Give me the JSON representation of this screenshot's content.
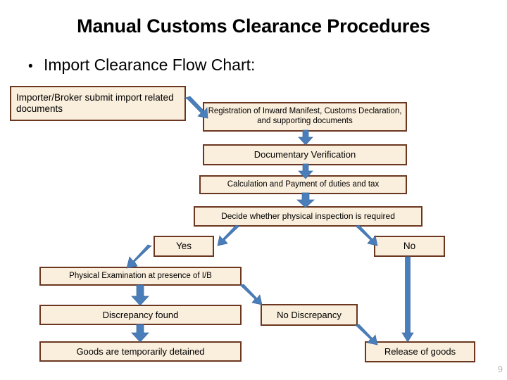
{
  "slide": {
    "title": "Manual Customs Clearance Procedures",
    "bullet_marker": "•",
    "bullet_text": "Import Clearance Flow Chart:",
    "page_number": "9",
    "colors": {
      "box_fill": "#faeedc",
      "box_border": "#6b3720",
      "arrow": "#4a7ebb",
      "text": "#000000",
      "background": "#ffffff"
    }
  },
  "chart_data": {
    "type": "diagram",
    "title": "Import Clearance Flow Chart",
    "nodes": [
      {
        "id": "n1",
        "label": "Importer/Broker submit import related documents"
      },
      {
        "id": "n2",
        "label": "Registration of Inward Manifest, Customs Declaration, and supporting documents"
      },
      {
        "id": "n3",
        "label": "Documentary Verification"
      },
      {
        "id": "n4",
        "label": "Calculation and Payment of duties and tax"
      },
      {
        "id": "n5",
        "label": "Decide whether physical inspection is required"
      },
      {
        "id": "n6",
        "label": "Yes"
      },
      {
        "id": "n7",
        "label": "No"
      },
      {
        "id": "n8",
        "label": "Physical Examination at presence of I/B"
      },
      {
        "id": "n9",
        "label": "Discrepancy found"
      },
      {
        "id": "n10",
        "label": "No Discrepancy"
      },
      {
        "id": "n11",
        "label": "Goods are temporarily detained"
      },
      {
        "id": "n12",
        "label": "Release of goods"
      }
    ],
    "edges": [
      {
        "from": "n1",
        "to": "n2",
        "style": "diagonal-down-right"
      },
      {
        "from": "n2",
        "to": "n3",
        "style": "vertical-down"
      },
      {
        "from": "n3",
        "to": "n4",
        "style": "vertical-down"
      },
      {
        "from": "n4",
        "to": "n5",
        "style": "vertical-down"
      },
      {
        "from": "n5",
        "to": "n6",
        "style": "diagonal-down-left"
      },
      {
        "from": "n5",
        "to": "n7",
        "style": "diagonal-down-right"
      },
      {
        "from": "n6",
        "to": "n8",
        "style": "diagonal-down-left"
      },
      {
        "from": "n7",
        "to": "n12",
        "style": "vertical-down-long"
      },
      {
        "from": "n8",
        "to": "n9",
        "style": "vertical-down"
      },
      {
        "from": "n8",
        "to": "n10",
        "style": "diagonal-down-right"
      },
      {
        "from": "n9",
        "to": "n11",
        "style": "vertical-down"
      },
      {
        "from": "n10",
        "to": "n12",
        "style": "diagonal-down-right"
      }
    ]
  },
  "boxes": {
    "importer_submit": "Importer/Broker submit import related documents",
    "registration": "Registration of Inward Manifest, Customs Declaration, and supporting documents",
    "documentary_verification": "Documentary Verification",
    "calculation_payment": "Calculation and Payment of duties and tax",
    "decide_inspection": "Decide whether physical inspection is required",
    "yes": "Yes",
    "no": "No",
    "physical_examination": "Physical Examination at presence of I/B",
    "discrepancy_found": "Discrepancy found",
    "no_discrepancy": "No Discrepancy",
    "goods_detained": "Goods are temporarily detained",
    "release_goods": "Release of goods"
  }
}
